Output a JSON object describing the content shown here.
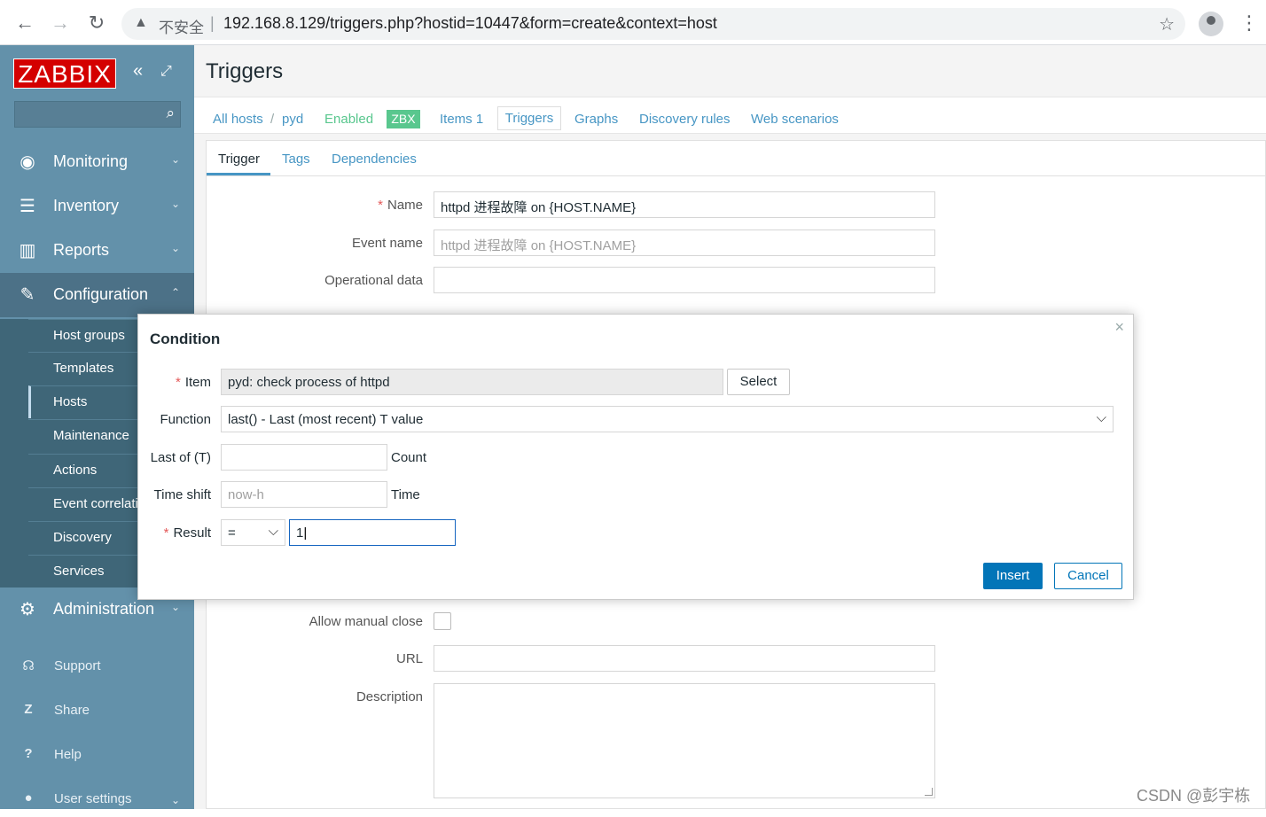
{
  "browser": {
    "back": "←",
    "forward": "→",
    "reload": "↻",
    "insecure_label": "不安全",
    "url": "192.168.8.129/triggers.php?hostid=10447&form=create&context=host"
  },
  "sidebar": {
    "logo": "ZABBIX",
    "menus": [
      {
        "label": "Monitoring",
        "icon": "eye-icon"
      },
      {
        "label": "Inventory",
        "icon": "list-icon"
      },
      {
        "label": "Reports",
        "icon": "chart-icon"
      },
      {
        "label": "Configuration",
        "icon": "wrench-icon"
      },
      {
        "label": "Administration",
        "icon": "gear-icon"
      }
    ],
    "config_items": [
      "Host groups",
      "Templates",
      "Hosts",
      "Maintenance",
      "Actions",
      "Event correlation",
      "Discovery",
      "Services"
    ],
    "footer": [
      {
        "label": "Support",
        "glyph": "☊"
      },
      {
        "label": "Share",
        "glyph": "Z"
      },
      {
        "label": "Help",
        "glyph": "?"
      },
      {
        "label": "User settings",
        "glyph": "●"
      }
    ]
  },
  "page": {
    "title": "Triggers",
    "host_nav": {
      "all_hosts": "All hosts",
      "separator": "/",
      "host": "pyd",
      "status": "Enabled",
      "agent": "ZBX",
      "items": "Items 1",
      "triggers": "Triggers",
      "graphs": "Graphs",
      "discovery": "Discovery rules",
      "web": "Web scenarios"
    },
    "tabs": [
      "Trigger",
      "Tags",
      "Dependencies"
    ],
    "form": {
      "name_label": "Name",
      "name_value": "httpd 进程故障 on {HOST.NAME}",
      "event_label": "Event name",
      "event_placeholder": "httpd 进程故障 on {HOST.NAME}",
      "opdata_label": "Operational data",
      "manual_close_label": "Allow manual close",
      "url_label": "URL",
      "description_label": "Description"
    }
  },
  "modal": {
    "title": "Condition",
    "item_label": "Item",
    "item_value": "pyd: check process of httpd",
    "select_button": "Select",
    "function_label": "Function",
    "function_value": "last() - Last (most recent) T value",
    "last_label": "Last of (T)",
    "last_suffix": "Count",
    "shift_label": "Time shift",
    "shift_placeholder": "now-h",
    "shift_suffix": "Time",
    "result_label": "Result",
    "result_operator": "=",
    "result_value": "1",
    "insert_button": "Insert",
    "cancel_button": "Cancel"
  },
  "watermark": "CSDN @彭宇栋"
}
